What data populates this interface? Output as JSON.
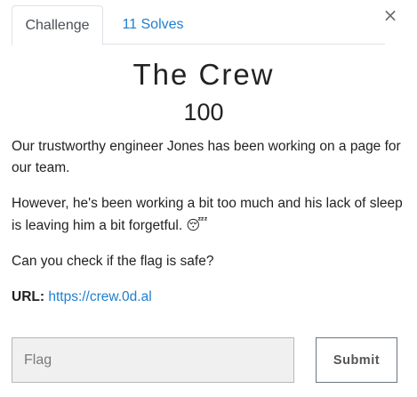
{
  "tabs": [
    {
      "label": "Challenge",
      "active": true
    },
    {
      "label": "11 Solves",
      "active": false
    }
  ],
  "close_glyph": "×",
  "challenge": {
    "title": "The Crew",
    "points": "100",
    "description": [
      "Our trustworthy engineer Jones has been working on a page for our team.",
      "However, he's been working a bit too much and his lack of sleep is leaving him a bit forgetful.",
      "Can you check if the flag is safe?"
    ],
    "sleep_emoji": "😴",
    "sleep_emoji_icon": "sleeping-face-icon",
    "url_label": "URL:",
    "url": "https://crew.0d.al"
  },
  "form": {
    "flag_placeholder": "Flag",
    "submit_label": "Submit"
  },
  "colors": {
    "link": "#1e7ed0",
    "border": "#dee2e6",
    "input_bg": "#f0f0f0"
  }
}
